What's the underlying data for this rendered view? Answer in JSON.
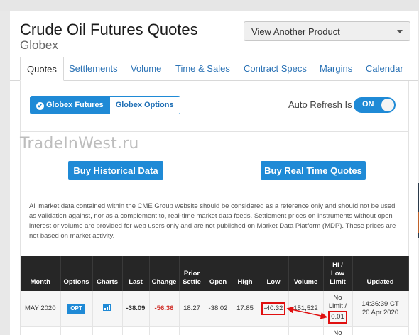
{
  "header": {
    "title": "Crude Oil Futures Quotes",
    "subtitle": "Globex",
    "product_select": "View Another Product"
  },
  "tabs": [
    {
      "label": "Quotes",
      "active": true
    },
    {
      "label": "Settlements"
    },
    {
      "label": "Volume"
    },
    {
      "label": "Time & Sales"
    },
    {
      "label": "Contract Specs"
    },
    {
      "label": "Margins"
    },
    {
      "label": "Calendar"
    }
  ],
  "toggle": {
    "futures_label": "Globex Futures",
    "options_label": "Globex Options"
  },
  "auto_refresh": {
    "label": "Auto Refresh Is",
    "state": "ON"
  },
  "watermark": "TradeInWest.ru",
  "buttons": {
    "historical": "Buy Historical Data",
    "realtime": "Buy Real Time Quotes"
  },
  "disclaimer": "All market data contained within the CME Group website should be considered as a reference only and should not be used as validation against, nor as a complement to, real-time market data feeds. Settlement prices on instruments without open interest or volume are provided for web users only and are not published on Market Data Platform (MDP). These prices are not based on market activity.",
  "table": {
    "headers": {
      "month": "Month",
      "options": "Options",
      "charts": "Charts",
      "last": "Last",
      "change": "Change",
      "prior_1": "Prior",
      "prior_2": "Settle",
      "open": "Open",
      "high": "High",
      "low": "Low",
      "volume": "Volume",
      "hilo_1": "Hi /",
      "hilo_2": "Low",
      "hilo_3": "Limit",
      "updated": "Updated"
    },
    "rows": [
      {
        "month": "MAY 2020",
        "options": "OPT",
        "last": "-38.09",
        "change": "-56.36",
        "prior_settle": "18.27",
        "open": "-38.02",
        "high": "17.85",
        "low": "-40.32",
        "volume": "151,522",
        "hilo_1": "No",
        "hilo_2": "Limit /",
        "hilo_3": "0.01",
        "updated_1": "14:36:39 CT",
        "updated_2": "20 Apr 2020"
      },
      {
        "hilo_1": "No"
      }
    ]
  },
  "colors": {
    "accent": "#1f8ad6",
    "negative": "#d0302a",
    "highlight": "#e01010",
    "header_bg": "#262626"
  }
}
